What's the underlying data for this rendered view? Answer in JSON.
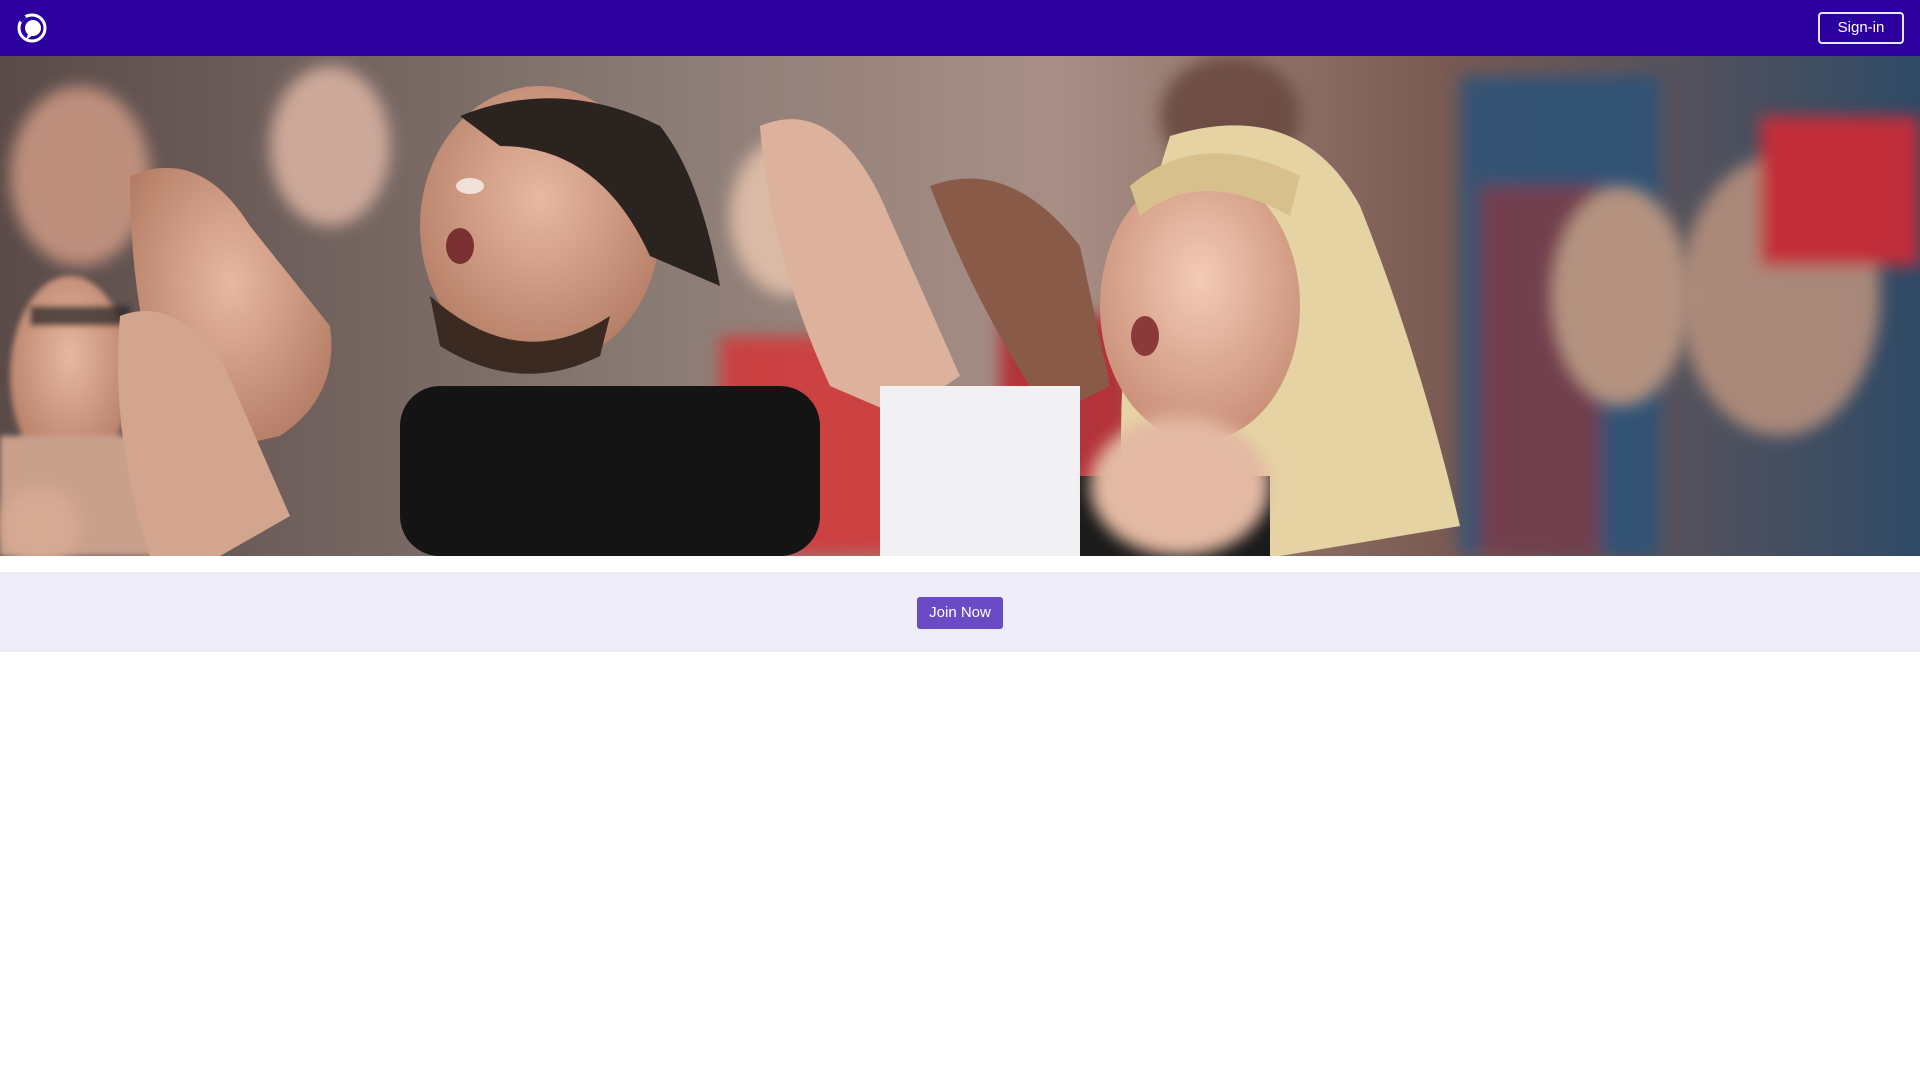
{
  "header": {
    "logo_icon": "chat-bubble-logo-icon",
    "signin_label": "Sign-in",
    "background_color": "#2c009e"
  },
  "hero": {
    "image_subject": "cheering-crowd-photo"
  },
  "cta": {
    "join_label": "Join Now",
    "button_color": "#6b4bc3",
    "band_color": "#efedf7"
  }
}
